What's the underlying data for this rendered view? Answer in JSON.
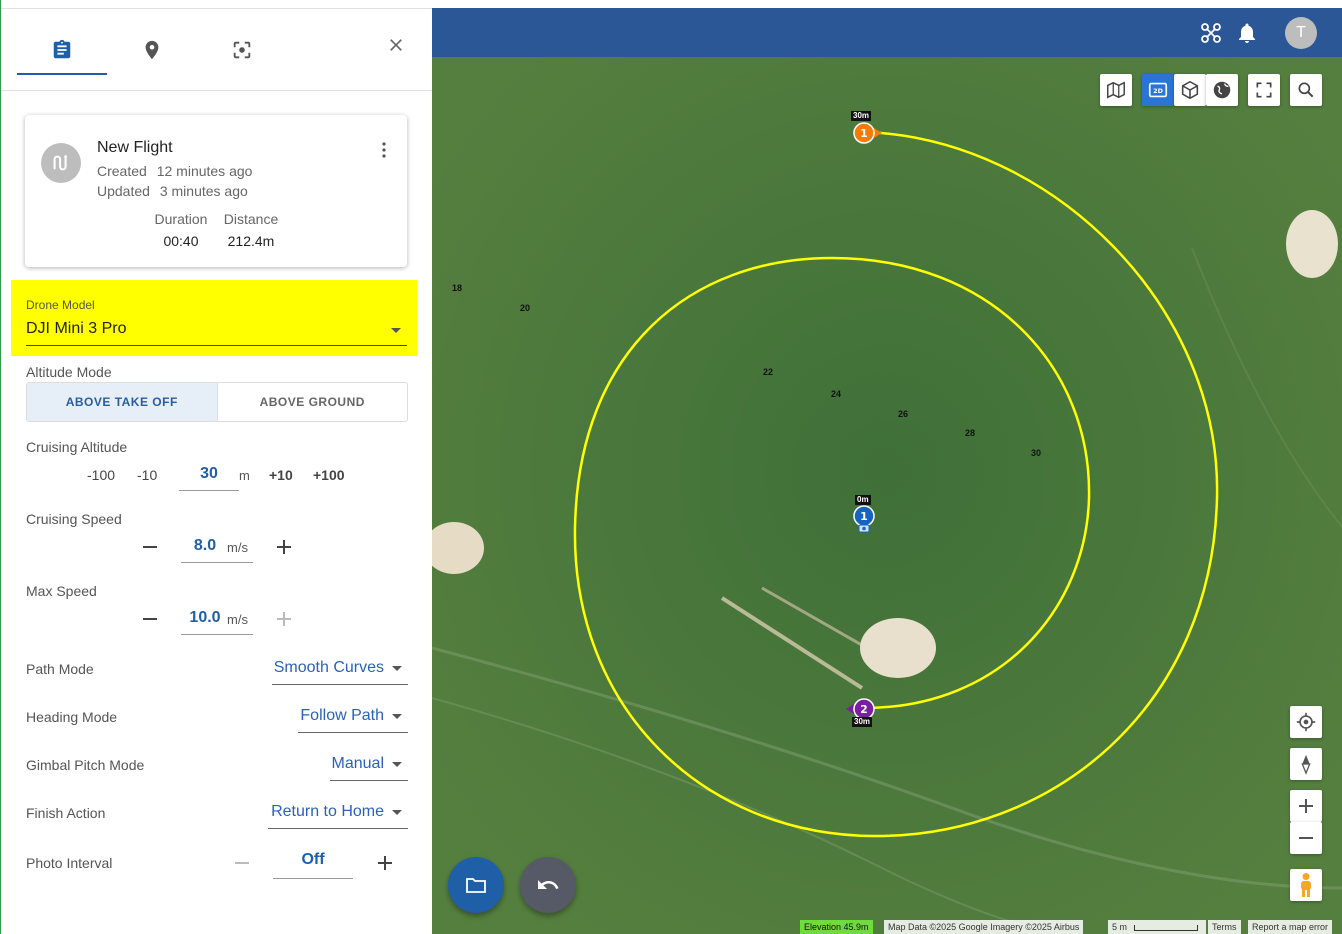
{
  "tabs": [
    {
      "name": "mission-tab",
      "icon": "clipboard-icon"
    },
    {
      "name": "location-tab",
      "icon": "map-pin-icon"
    },
    {
      "name": "focus-tab",
      "icon": "focus-frame-icon"
    }
  ],
  "flight": {
    "title": "New Flight",
    "created_label": "Created",
    "created_value": "12 minutes ago",
    "updated_label": "Updated",
    "updated_value": "3 minutes ago",
    "duration_label": "Duration",
    "duration_value": "00:40",
    "distance_label": "Distance",
    "distance_value": "212.4m"
  },
  "drone_model": {
    "label": "Drone Model",
    "value": "DJI Mini 3 Pro"
  },
  "altitude_mode": {
    "label": "Altitude Mode",
    "options": [
      "ABOVE TAKE OFF",
      "ABOVE GROUND"
    ],
    "selected": "ABOVE TAKE OFF"
  },
  "cruising_altitude": {
    "label": "Cruising Altitude",
    "minus100": "-100",
    "minus10": "-10",
    "value": "30",
    "unit": "m",
    "plus10": "+10",
    "plus100": "+100"
  },
  "cruising_speed": {
    "label": "Cruising Speed",
    "value": "8.0",
    "unit": "m/s"
  },
  "max_speed": {
    "label": "Max Speed",
    "value": "10.0",
    "unit": "m/s"
  },
  "path_mode": {
    "label": "Path Mode",
    "value": "Smooth Curves"
  },
  "heading_mode": {
    "label": "Heading Mode",
    "value": "Follow Path"
  },
  "gimbal_pitch_mode": {
    "label": "Gimbal Pitch Mode",
    "value": "Manual"
  },
  "finish_action": {
    "label": "Finish Action",
    "value": "Return to Home"
  },
  "photo_interval": {
    "label": "Photo Interval",
    "value": "Off"
  },
  "map": {
    "user_initial": "T",
    "contours": [
      "18",
      "20",
      "22",
      "24",
      "26",
      "28",
      "30"
    ],
    "waypoints": [
      {
        "num": "1",
        "alt": "30m",
        "color": "#f57c00"
      },
      {
        "num": "1",
        "alt": "0m",
        "color": "#1565c0"
      },
      {
        "num": "2",
        "alt": "30m",
        "color": "#7b1fa2"
      }
    ],
    "path_color": "#ffff00",
    "attribution": {
      "elevation": "Elevation 45.9m",
      "map_data": "Map Data ©2025 Google Imagery ©2025 Airbus",
      "scale": "5 m",
      "terms": "Terms",
      "report": "Report a map error"
    }
  },
  "colors": {
    "accent": "#1e5fa8",
    "topbar": "#2b5797",
    "highlight": "#ffff00"
  }
}
